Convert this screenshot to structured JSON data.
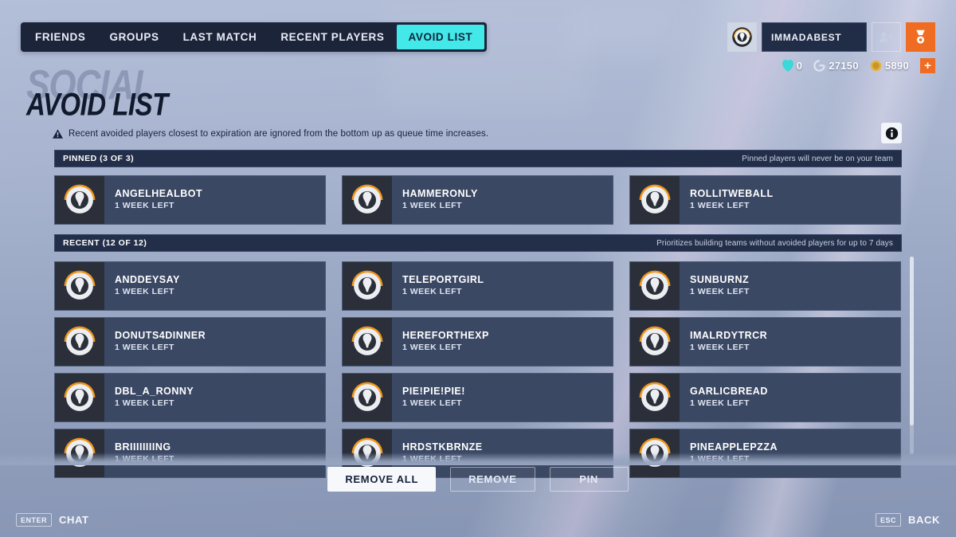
{
  "nav": {
    "tabs": [
      {
        "label": "FRIENDS",
        "active": false
      },
      {
        "label": "GROUPS",
        "active": false
      },
      {
        "label": "LAST MATCH",
        "active": false
      },
      {
        "label": "RECENT PLAYERS",
        "active": false
      },
      {
        "label": "AVOID LIST",
        "active": true
      }
    ]
  },
  "account": {
    "avatar_icon": "overwatch-logo-icon",
    "username": "IMMADABEST",
    "friends_button_icon": "add-friend-icon",
    "endorsement_button_icon": "endorsement-icon"
  },
  "currency": {
    "items": [
      {
        "icon": "overwatch-coin-icon",
        "value": "0"
      },
      {
        "icon": "competitive-points-icon",
        "value": "27150"
      },
      {
        "icon": "legacy-credits-icon",
        "value": "5890"
      }
    ],
    "add_label": "+"
  },
  "header": {
    "ghost_title": "SOCIAL",
    "page_title": "AVOID LIST",
    "warning_icon": "warning-triangle-icon",
    "warning_text": "Recent avoided players closest to expiration are ignored from the bottom up as queue time increases.",
    "info_icon": "info-icon"
  },
  "pinned": {
    "title": "PINNED (3 OF 3)",
    "note": "Pinned players will never be on your team",
    "players": [
      {
        "name": "ANGELHEALBOT",
        "time": "1 WEEK LEFT"
      },
      {
        "name": "HAMMERONLY",
        "time": "1 WEEK LEFT"
      },
      {
        "name": "ROLLITWEBALL",
        "time": "1 WEEK LEFT"
      }
    ]
  },
  "recent": {
    "title": "RECENT (12 OF 12)",
    "note": "Prioritizes building teams without avoided players for up to 7 days",
    "players": [
      {
        "name": "ANDDEYSAY",
        "time": "1 WEEK LEFT"
      },
      {
        "name": "TELEPORTGIRL",
        "time": "1 WEEK LEFT"
      },
      {
        "name": "SUNBURNZ",
        "time": "1 WEEK LEFT"
      },
      {
        "name": "DONUTS4DINNER",
        "time": "1 WEEK LEFT"
      },
      {
        "name": "HEREFORTHEXP",
        "time": "1 WEEK LEFT"
      },
      {
        "name": "IMALRDYTRCR",
        "time": "1 WEEK LEFT"
      },
      {
        "name": "DBL_A_RONNY",
        "time": "1 WEEK LEFT"
      },
      {
        "name": "PIE!PIE!PIE!",
        "time": "1 WEEK LEFT"
      },
      {
        "name": "GARLICBREAD",
        "time": "1 WEEK LEFT"
      },
      {
        "name": "BRIIIIIIIING",
        "time": "1 WEEK LEFT"
      },
      {
        "name": "HRDSTKBRNZE",
        "time": "1 WEEK LEFT"
      },
      {
        "name": "PINEAPPLEPZZA",
        "time": "1 WEEK LEFT"
      }
    ]
  },
  "actions": {
    "remove_all": "REMOVE ALL",
    "remove": "REMOVE",
    "pin": "PIN"
  },
  "footer": {
    "left_key": "ENTER",
    "left_label": "CHAT",
    "right_key": "ESC",
    "right_label": "BACK"
  },
  "colors": {
    "accent_cyan": "#43e8e8",
    "accent_orange": "#f06c22",
    "panel_dark": "#232e49",
    "card": "#3b4864"
  }
}
